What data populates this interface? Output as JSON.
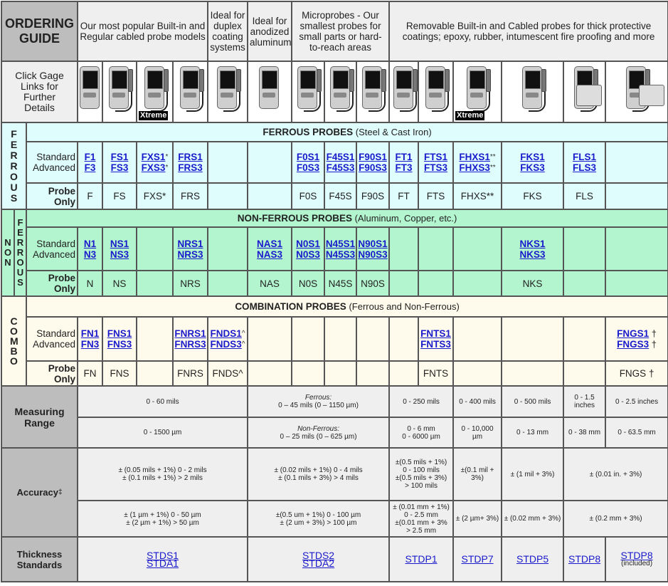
{
  "header": {
    "title_lines": [
      "ORDERING",
      "GUIDE"
    ],
    "groups": [
      "Our most popular Built-in and Regular cabled probe models",
      "Ideal for duplex coating systems",
      "Ideal for anodized aluminum",
      "Microprobes - Our smallest probes for small parts or hard-to-reach areas",
      "Removable Built-in and Cabled probes for thick protective coatings; epoxy, rubber, intumescent fire proofing and more"
    ],
    "click_text": "Click Gage Links for Further Details",
    "xtreme_label": "Xtreme"
  },
  "labels": {
    "standard": "Standard",
    "advanced": "Advanced",
    "probe": "Probe",
    "only": "Only"
  },
  "sections": {
    "ferrous": {
      "side": "FERROUS",
      "title": "FERROUS PROBES",
      "sub": " (Steel & Cast Iron)"
    },
    "nonferrous": {
      "side_a": "NON",
      "side_b": "FERROUS",
      "title": "NON-FERROUS PROBES",
      "sub": " (Aluminum, Copper, etc.)"
    },
    "combo": {
      "side": "COMBO",
      "title": "COMBINATION PROBES",
      "sub": " (Ferrous and Non-Ferrous)"
    }
  },
  "columns": [
    {
      "ferrous": {
        "std": "F1",
        "adv": "F3",
        "mark": "",
        "probe": "F"
      },
      "nonferrous": {
        "std": "N1",
        "adv": "N3",
        "mark": "",
        "probe": "N"
      },
      "combo": {
        "std": "FN1",
        "adv": "FN3",
        "mark": "",
        "probe": "FN"
      }
    },
    {
      "ferrous": {
        "std": "FS1",
        "adv": "FS3",
        "mark": "",
        "probe": "FS"
      },
      "nonferrous": {
        "std": "NS1",
        "adv": "NS3",
        "mark": "",
        "probe": "NS"
      },
      "combo": {
        "std": "FNS1",
        "adv": "FNS3",
        "mark": "",
        "probe": "FNS"
      }
    },
    {
      "xtreme": true,
      "ferrous": {
        "std": "FXS1",
        "adv": "FXS3",
        "mark": "*",
        "probe": "FXS*"
      }
    },
    {
      "ferrous": {
        "std": "FRS1",
        "adv": "FRS3",
        "mark": "",
        "probe": "FRS"
      },
      "nonferrous": {
        "std": "NRS1",
        "adv": "NRS3",
        "mark": "",
        "probe": "NRS"
      },
      "combo": {
        "std": "FNRS1",
        "adv": "FNRS3",
        "mark": "",
        "probe": "FNRS"
      }
    },
    {
      "combo": {
        "std": "FNDS1",
        "adv": "FNDS3",
        "mark": "^",
        "probe": "FNDS^"
      }
    },
    {
      "nonferrous": {
        "std": "NAS1",
        "adv": "NAS3",
        "mark": "",
        "probe": "NAS"
      }
    },
    {
      "ferrous": {
        "std": "F0S1",
        "adv": "F0S3",
        "mark": "",
        "probe": "F0S"
      },
      "nonferrous": {
        "std": "N0S1",
        "adv": "N0S3",
        "mark": "",
        "probe": "N0S"
      }
    },
    {
      "ferrous": {
        "std": "F45S1",
        "adv": "F45S3",
        "mark": "",
        "probe": "F45S"
      },
      "nonferrous": {
        "std": "N45S1",
        "adv": "N45S3",
        "mark": "",
        "probe": "N45S"
      }
    },
    {
      "ferrous": {
        "std": "F90S1",
        "adv": "F90S3",
        "mark": "",
        "probe": "F90S"
      },
      "nonferrous": {
        "std": "N90S1",
        "adv": "N90S3",
        "mark": "",
        "probe": "N90S"
      }
    },
    {
      "ferrous": {
        "std": "FT1",
        "adv": "FT3",
        "mark": "",
        "probe": "FT"
      }
    },
    {
      "ferrous": {
        "std": "FTS1",
        "adv": "FTS3",
        "mark": "",
        "probe": "FTS"
      },
      "combo": {
        "std": "FNTS1",
        "adv": "FNTS3",
        "mark": "",
        "probe": "FNTS"
      }
    },
    {
      "xtreme": true,
      "ferrous": {
        "std": "FHXS1",
        "adv": "FHXS3",
        "mark": "**",
        "probe": "FHXS**"
      }
    },
    {
      "ferrous": {
        "std": "FKS1",
        "adv": "FKS3",
        "mark": "",
        "probe": "FKS"
      },
      "nonferrous": {
        "std": "NKS1",
        "adv": "NKS3",
        "mark": "",
        "probe": "NKS"
      }
    },
    {
      "ferrous": {
        "std": "FLS1",
        "adv": "FLS3",
        "mark": "",
        "probe": "FLS"
      }
    },
    {
      "combo": {
        "std": "FNGS1",
        "adv": "FNGS3",
        "mark": " †",
        "probe": "FNGS †"
      }
    }
  ],
  "specs": {
    "measuring_range_label": "Measuring Range",
    "range_imperial": [
      {
        "lines": [
          "0 - 60 mils"
        ]
      },
      {
        "label": "Ferrous:",
        "lines": [
          "0 – 45 mils (0 – 1150 µm)"
        ]
      },
      {
        "lines": [
          "0 - 250 mils"
        ]
      },
      {
        "lines": [
          "0 - 400 mils"
        ]
      },
      {
        "lines": [
          "0 - 500 mils"
        ]
      },
      {
        "lines": [
          "0 - 1.5",
          "inches"
        ]
      },
      {
        "lines": [
          "0 - 2.5 inches"
        ]
      }
    ],
    "range_metric": [
      {
        "lines": [
          "0 - 1500 µm"
        ]
      },
      {
        "label": "Non-Ferrous:",
        "lines": [
          "0 – 25 mils (0 – 625 µm)"
        ]
      },
      {
        "lines": [
          "0 - 6 mm",
          "0 - 6000 µm"
        ]
      },
      {
        "lines": [
          "0 - 10,000",
          "µm"
        ]
      },
      {
        "lines": [
          "0 - 13 mm"
        ]
      },
      {
        "lines": [
          "0 - 38 mm"
        ]
      },
      {
        "lines": [
          "0 - 63.5 mm"
        ]
      }
    ],
    "accuracy_label": "Accuracy",
    "accuracy_mark": "‡",
    "accuracy_imperial": [
      {
        "lines": [
          "± (0.05 mils + 1%)  0 - 2 mils",
          "± (0.1 mils  +  1%)  > 2 mils"
        ]
      },
      {
        "lines": [
          "± (0.02 mils + 1%)  0 - 4 mils",
          "± (0.1 mils + 3%)  > 4 mils"
        ]
      },
      {
        "lines": [
          "±(0.5 mils + 1%)",
          "0 - 100 mils",
          "±(0.5 mils + 3%)",
          "> 100 mils"
        ]
      },
      {
        "lines": [
          "±(0.1 mil +",
          "3%)"
        ]
      },
      {
        "lines": [
          "± (1 mil + 3%)"
        ]
      },
      {
        "lines": [
          "± (0.01 in. + 3%)"
        ]
      }
    ],
    "accuracy_metric": [
      {
        "lines": [
          "± (1 µm + 1%)  0 - 50 µm",
          "± (2 µm + 1%)  > 50 µm"
        ]
      },
      {
        "lines": [
          "±(0.5 um + 1%)  0 - 100 µm",
          "± (2 um + 3%)  > 100 µm"
        ]
      },
      {
        "lines": [
          "± (0.01 mm + 1%)",
          "0 - 2.5 mm",
          "±(0.01 mm + 3%",
          "> 2.5 mm"
        ]
      },
      {
        "lines": [
          "± (2 µm+ 3%)"
        ]
      },
      {
        "lines": [
          "± (0.02 mm + 3%)"
        ]
      },
      {
        "lines": [
          "± (0.2 mm + 3%)"
        ]
      }
    ],
    "thickness_label": "Thickness Standards",
    "thickness": [
      {
        "links": [
          "STDS1",
          "STDA1"
        ]
      },
      {
        "links": [
          "STDS2",
          "STDA2"
        ]
      },
      {
        "links": [
          "STDP1"
        ]
      },
      {
        "links": [
          "STDP7"
        ]
      },
      {
        "links": [
          "STDP5"
        ]
      },
      {
        "links": [
          "STDP8"
        ]
      },
      {
        "links": [
          "STDP8"
        ],
        "note": "(included)"
      }
    ]
  },
  "colors": {
    "ferrous": "#e0fdfd",
    "nonferrous": "#b3f5cf",
    "combo": "#fffbec",
    "label_gray": "#bdbdbd",
    "link": "#1a1acc"
  }
}
